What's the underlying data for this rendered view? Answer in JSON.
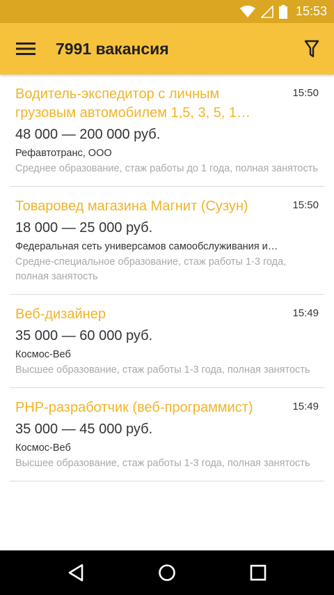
{
  "status_bar": {
    "time": "15:53",
    "icons": [
      "wifi-icon",
      "signal-icon",
      "battery-icon"
    ]
  },
  "app_bar": {
    "title": "7991 вакансия",
    "menu_icon": "hamburger-menu-icon",
    "filter_icon": "filter-icon"
  },
  "vacancies": [
    {
      "title": "Водитель-экспедитор с личным грузовым автомобилем 1,5, 3, 5, 1…",
      "time": "15:50",
      "salary": "48 000 — 200 000 руб.",
      "company": "Рефавтотранс, ООО",
      "description": "Среднее образование, стаж работы до 1 года, полная занятость"
    },
    {
      "title": "Товаровед магазина Магнит (Сузун)",
      "time": "15:50",
      "salary": "18 000 — 25 000 руб.",
      "company": "Федеральная сеть универсамов самообслуживания и…",
      "description": "Средне-специальное образование, стаж работы 1-3 года, полная занятость"
    },
    {
      "title": "Веб-дизайнер",
      "time": "15:49",
      "salary": "35 000 — 60 000 руб.",
      "company": "Космос-Веб",
      "description": "Высшее образование, стаж работы 1-3 года, полная занятость"
    },
    {
      "title": "PHP-разработчик (веб-программист)",
      "time": "15:49",
      "salary": "35 000 — 45 000 руб.",
      "company": "Космос-Веб",
      "description": "Высшее образование, стаж работы 1-3 года, полная занятость"
    }
  ],
  "nav_bar": {
    "icons": [
      "back-icon",
      "home-icon",
      "recents-icon"
    ]
  },
  "colors": {
    "status_bar": "#dba621",
    "app_bar": "#f6c23c",
    "accent_title": "#f0b429"
  }
}
